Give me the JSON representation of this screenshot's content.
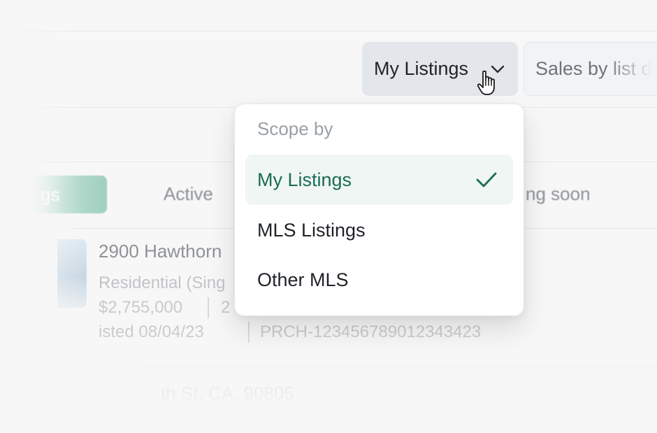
{
  "toolbar": {
    "scope_button_label": "My Listings",
    "sales_button_label": "Sales by list d"
  },
  "tabs": [
    {
      "label": "gs",
      "active": true
    },
    {
      "label": "Active",
      "active": false
    },
    {
      "label": "ng soon",
      "active": false
    }
  ],
  "listings": [
    {
      "address": "2900 Hawthorn",
      "type": "Residential (Sing",
      "price": "$2,755,000",
      "beds": "2",
      "listed": "isted 08/04/23",
      "id": "PRCH-123456789012343423"
    },
    {
      "address": "th St, CA, 90805"
    }
  ],
  "dropdown": {
    "heading": "Scope by",
    "items": [
      {
        "label": "My Listings",
        "selected": true
      },
      {
        "label": "MLS Listings",
        "selected": false
      },
      {
        "label": "Other MLS",
        "selected": false
      }
    ]
  },
  "colors": {
    "accent": "#1c6b55",
    "selected_bg": "#eff6f3",
    "scope_button_bg": "#e3e6ea"
  },
  "icons": [
    "chevron-down-icon",
    "hand-pointer-icon",
    "check-icon",
    "listing-thumbnail"
  ]
}
